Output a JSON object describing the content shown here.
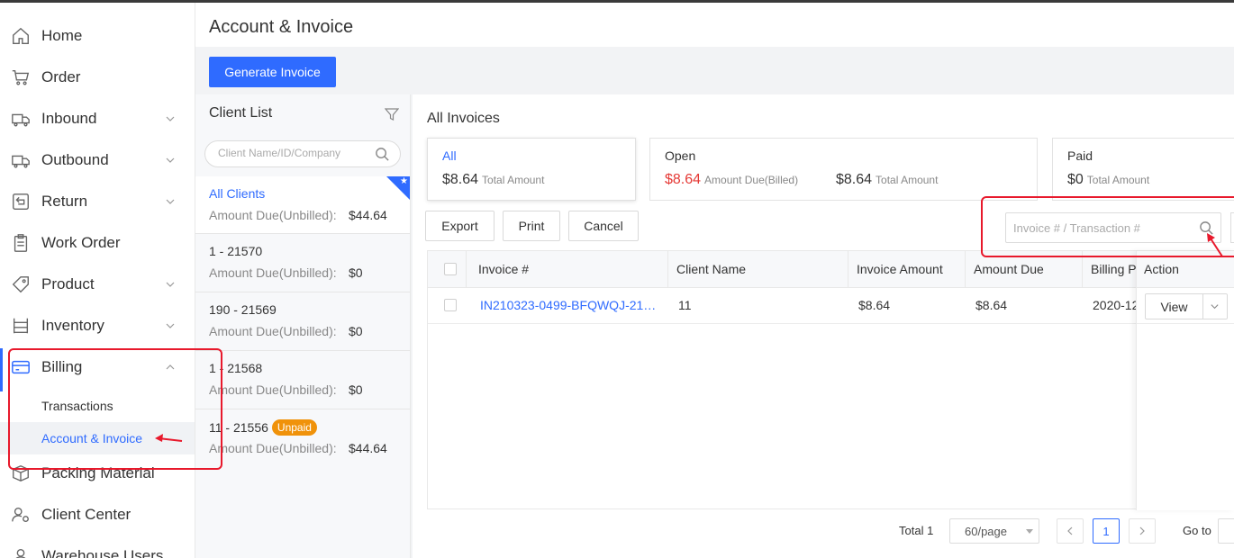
{
  "page": {
    "title": "Account & Invoice",
    "primary_action": "Generate Invoice"
  },
  "sidebar": {
    "items": [
      {
        "label": "Home",
        "icon": "home-icon",
        "expandable": false
      },
      {
        "label": "Order",
        "icon": "cart-icon",
        "expandable": false
      },
      {
        "label": "Inbound",
        "icon": "truck-in-icon",
        "expandable": true
      },
      {
        "label": "Outbound",
        "icon": "truck-out-icon",
        "expandable": true
      },
      {
        "label": "Return",
        "icon": "return-icon",
        "expandable": true
      },
      {
        "label": "Work Order",
        "icon": "clipboard-icon",
        "expandable": false
      },
      {
        "label": "Product",
        "icon": "tag-icon",
        "expandable": true
      },
      {
        "label": "Inventory",
        "icon": "shelves-icon",
        "expandable": true
      },
      {
        "label": "Billing",
        "icon": "card-icon",
        "expandable": true,
        "expanded": true
      },
      {
        "label": "Packing Material",
        "icon": "box-icon",
        "expandable": false
      },
      {
        "label": "Client Center",
        "icon": "users-gear-icon",
        "expandable": false
      },
      {
        "label": "Warehouse Users",
        "icon": "user-icon",
        "expandable": false
      }
    ],
    "billing_sub": [
      {
        "label": "Transactions",
        "active": false
      },
      {
        "label": "Account & Invoice",
        "active": true
      }
    ]
  },
  "client_list": {
    "title": "Client List",
    "search_placeholder": "Client Name/ID/Company",
    "items": [
      {
        "name": "All Clients",
        "due_label": "Amount Due(Unbilled):",
        "due": "$44.64",
        "selected": true
      },
      {
        "name": "1 - 21570",
        "due_label": "Amount Due(Unbilled):",
        "due": "$0"
      },
      {
        "name": "190 - 21569",
        "due_label": "Amount Due(Unbilled):",
        "due": "$0"
      },
      {
        "name": "1 - 21568",
        "due_label": "Amount Due(Unbilled):",
        "due": "$0"
      },
      {
        "name": "11 - 21556",
        "badge": "Unpaid",
        "due_label": "Amount Due(Unbilled):",
        "due": "$44.64"
      }
    ]
  },
  "invoices": {
    "title": "All Invoices",
    "cards": {
      "all": {
        "label": "All",
        "amount": "$8.64",
        "sub": "Total Amount"
      },
      "open": {
        "label": "Open",
        "due_amount": "$8.64",
        "due_sub": "Amount Due(Billed)",
        "total_amount": "$8.64",
        "total_sub": "Total Amount"
      },
      "paid": {
        "label": "Paid",
        "amount": "$0",
        "sub": "Total Amount"
      }
    },
    "buttons": {
      "export": "Export",
      "print": "Print",
      "cancel": "Cancel"
    },
    "search_placeholder": "Invoice # / Transaction #",
    "columns": [
      "Invoice #",
      "Client Name",
      "Invoice Amount",
      "Amount Due",
      "Billing P",
      "Action"
    ],
    "rows": [
      {
        "invoice": "IN210323-0499-BFQWQJ-21…",
        "client": "11",
        "amount": "$8.64",
        "due": "$8.64",
        "billing": "2020-12",
        "action": "View"
      }
    ]
  },
  "pagination": {
    "total": "Total 1",
    "page_size": "60/page",
    "current_page": "1",
    "goto": "Go to"
  },
  "colors": {
    "accent": "#2f6bff",
    "annotation": "#e8192c",
    "badge": "#f0920a",
    "negative": "#e53935"
  }
}
